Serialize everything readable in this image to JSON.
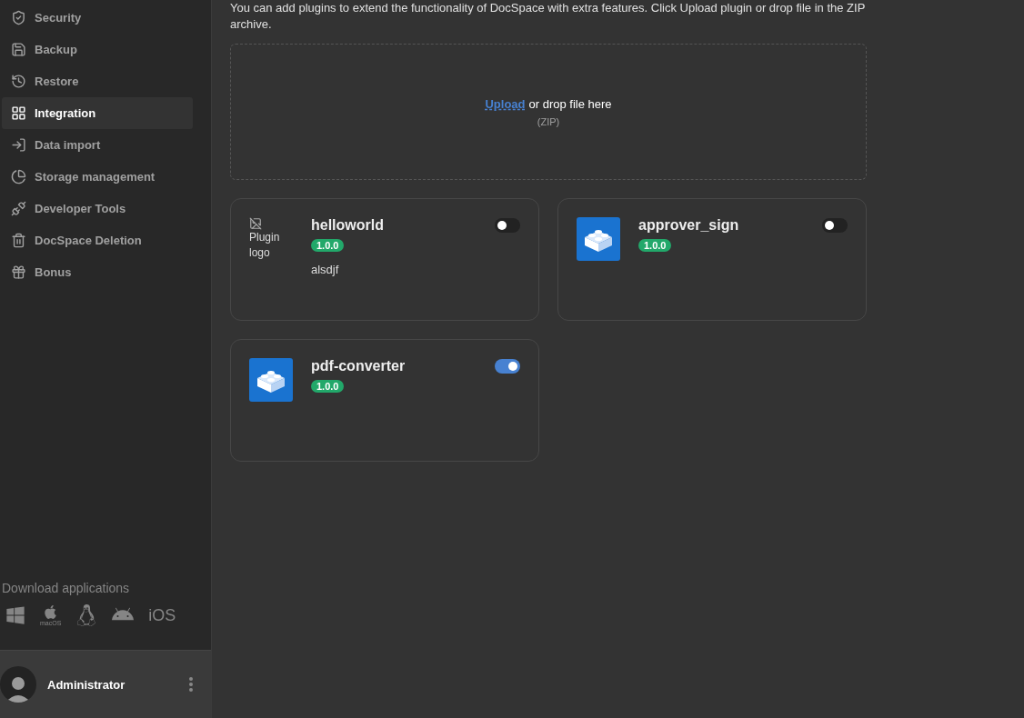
{
  "sidebar": {
    "items": [
      {
        "label": "Security",
        "selected": false
      },
      {
        "label": "Backup",
        "selected": false
      },
      {
        "label": "Restore",
        "selected": false
      },
      {
        "label": "Integration",
        "selected": true
      },
      {
        "label": "Data import",
        "selected": false
      },
      {
        "label": "Storage management",
        "selected": false
      },
      {
        "label": "Developer Tools",
        "selected": false
      },
      {
        "label": "DocSpace Deletion",
        "selected": false
      },
      {
        "label": "Bonus",
        "selected": false
      }
    ],
    "download": {
      "title": "Download applications",
      "apps": [
        {
          "kind": "windows"
        },
        {
          "kind": "macos",
          "label": "macOS"
        },
        {
          "kind": "linux"
        },
        {
          "kind": "android"
        },
        {
          "kind": "ios",
          "label": "iOS"
        }
      ]
    },
    "user": {
      "name": "Administrator"
    }
  },
  "description": "You can add plugins to extend the functionality of DocSpace with extra features. Click Upload plugin or drop file in the ZIP archive.",
  "dropzone": {
    "link": "Upload",
    "text": "or drop file here",
    "hint": "(ZIP)"
  },
  "plugins": [
    {
      "name": "helloworld",
      "version": "1.0.0",
      "description": "alsdjf",
      "kind": "broken-logo",
      "logo_alt": "Plugin logo",
      "on": false
    },
    {
      "name": "approver_sign",
      "version": "1.0.0",
      "kind": "logo",
      "on": false
    },
    {
      "name": "pdf-converter",
      "version": "1.0.0",
      "kind": "logo",
      "on": true
    }
  ]
}
